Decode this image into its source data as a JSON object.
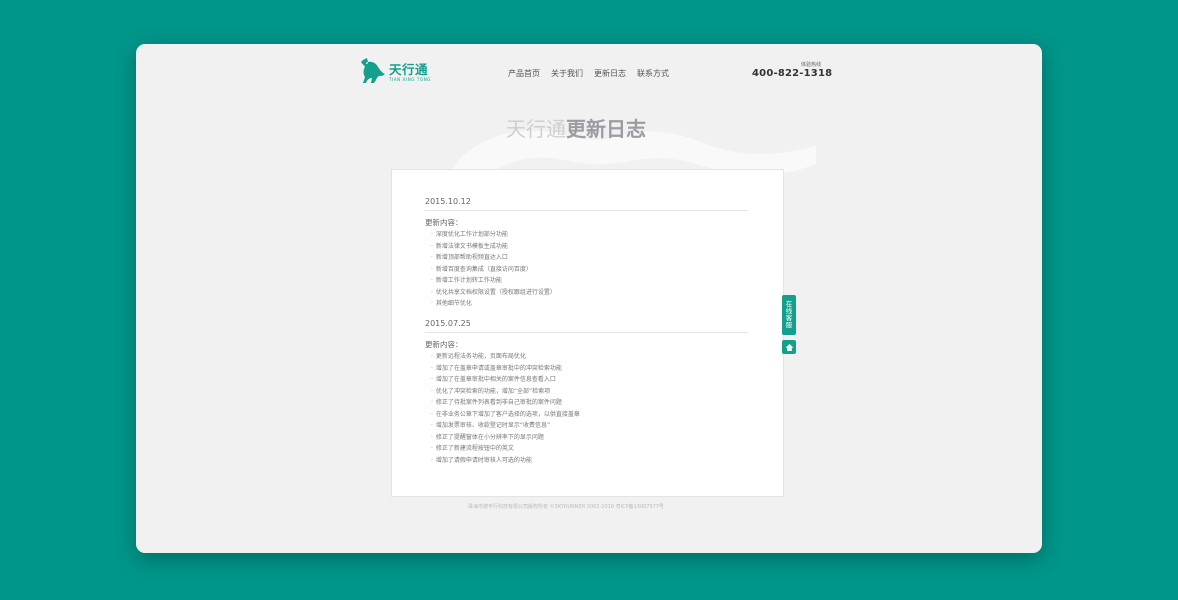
{
  "logo": {
    "name": "天行通",
    "sub": "TIAN XING TONG"
  },
  "nav": [
    "产品首页",
    "关于我们",
    "更新日志",
    "联系方式"
  ],
  "hotline": {
    "label": "体验热线",
    "number": "400-822-1318"
  },
  "title": {
    "light": "天行通",
    "bold": "更新日志"
  },
  "entries": [
    {
      "date": "2015.10.12",
      "heading": "更新内容：",
      "items": [
        "深度优化工作计划部分功能",
        "新增法律文书模板生成功能",
        "新增顶部帮助视频直达入口",
        "新增百度查询集成（直接访问百度）",
        "新增工作计划转工作功能",
        "优化共享文档权限设置（授权跟组进行设置）",
        "其他细节优化"
      ]
    },
    {
      "date": "2015.07.25",
      "heading": "更新内容：",
      "items": [
        "更新远程法务功能，页面布局优化",
        "增加了在盖章申请或盖章审批中的冲突检索功能",
        "增加了在盖章审批中相关的案件信息查看入口",
        "优化了冲突检索的功能，增加“全部”检索项",
        "修正了待批案件列表看到非自己审批的案件问题",
        "在非业务公章下增加了客户选择的选项，以供直接盖章",
        "增加发票审核、收款登记时显示“收费信息”",
        "修正了提醒窗体在小分辨率下的显示问题",
        "修正了新建流程按钮中的英文",
        "增加了请假申请时审核人可选的功能"
      ]
    }
  ],
  "footer": "珠海市德丰行科技有限公司版权所有 ©SKYRUNNER 2002-2016 粤ICP备13007577号",
  "side": {
    "service": "在线客服"
  },
  "colors": {
    "brand": "#15a08e",
    "outer": "#00968a"
  },
  "icons": {
    "back_to_top": "home-up-icon"
  }
}
